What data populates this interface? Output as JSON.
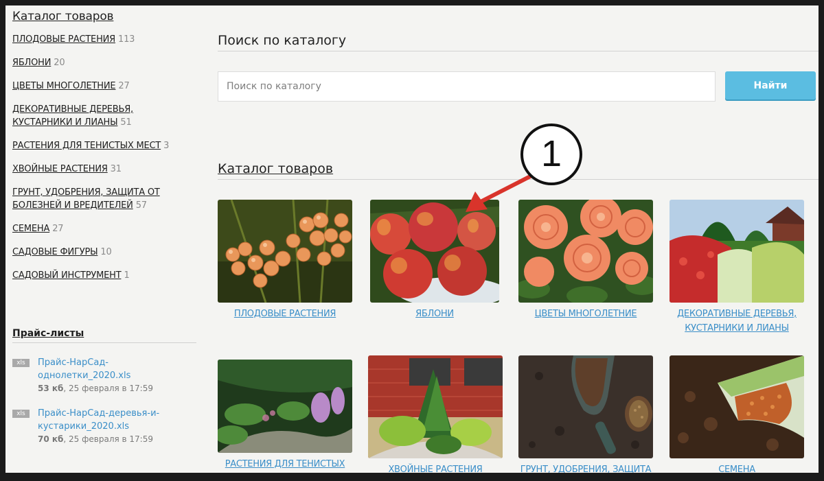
{
  "sidebar": {
    "title": "Каталог товаров",
    "categories": [
      {
        "label": "ПЛОДОВЫЕ РАСТЕНИЯ",
        "count": "113"
      },
      {
        "label": "ЯБЛОНИ",
        "count": "20"
      },
      {
        "label": "ЦВЕТЫ МНОГОЛЕТНИЕ",
        "count": "27"
      },
      {
        "label": "ДЕКОРАТИВНЫЕ ДЕРЕВЬЯ, КУСТАРНИКИ И ЛИАНЫ",
        "count": "51"
      },
      {
        "label": "РАСТЕНИЯ ДЛЯ ТЕНИСТЫХ МЕСТ",
        "count": "3"
      },
      {
        "label": "ХВОЙНЫЕ РАСТЕНИЯ",
        "count": "31"
      },
      {
        "label": "ГРУНТ, УДОБРЕНИЯ, ЗАЩИТА ОТ БОЛЕЗНЕЙ И ВРЕДИТЕЛЕЙ",
        "count": "57"
      },
      {
        "label": "СЕМЕНА",
        "count": "27"
      },
      {
        "label": "САДОВЫЕ ФИГУРЫ",
        "count": "10"
      },
      {
        "label": "САДОВЫЙ ИНСТРУМЕНТ",
        "count": "1"
      }
    ],
    "price_lists": {
      "title": "Прайс-листы",
      "items": [
        {
          "ext": "xls",
          "name": "Прайс-НарСад-однолетки_2020.xls",
          "size": "53 кб",
          "date": "25 февраля в 17:59"
        },
        {
          "ext": "xls",
          "name": "Прайс-НарСад-деревья-и-кустарики_2020.xls",
          "size": "70 кб",
          "date": "25 февраля в 17:59"
        }
      ]
    }
  },
  "search": {
    "title": "Поиск по каталогу",
    "placeholder": "Поиск по каталогу",
    "button": "Найти"
  },
  "catalog": {
    "title": "Каталог товаров",
    "tiles": [
      {
        "label": "ПЛОДОВЫЕ РАСТЕНИЯ",
        "image": "red-currant-photo"
      },
      {
        "label": "ЯБЛОНИ",
        "image": "apples-photo"
      },
      {
        "label": "ЦВЕТЫ МНОГОЛЕТНИЕ",
        "image": "roses-photo"
      },
      {
        "label": "ДЕКОРАТИВНЫЕ ДЕРЕВЬЯ, КУСТАРНИКИ И ЛИАНЫ",
        "image": "hedge-garden-photo"
      },
      {
        "label": "РАСТЕНИЯ ДЛЯ ТЕНИСТЫХ МЕСТ",
        "image": "shade-garden-photo"
      },
      {
        "label": "ХВОЙНЫЕ РАСТЕНИЯ",
        "image": "conifers-photo"
      },
      {
        "label": "ГРУНТ, УДОБРЕНИЯ, ЗАЩИТА ОТ БОЛЕЗНЕЙ И ВРЕДИТЕЛЕЙ",
        "image": "soil-scoop-photo"
      },
      {
        "label": "СЕМЕНА",
        "image": "seeds-packet-photo"
      }
    ]
  },
  "annotation": {
    "number": "1",
    "color": "#d9342b"
  }
}
